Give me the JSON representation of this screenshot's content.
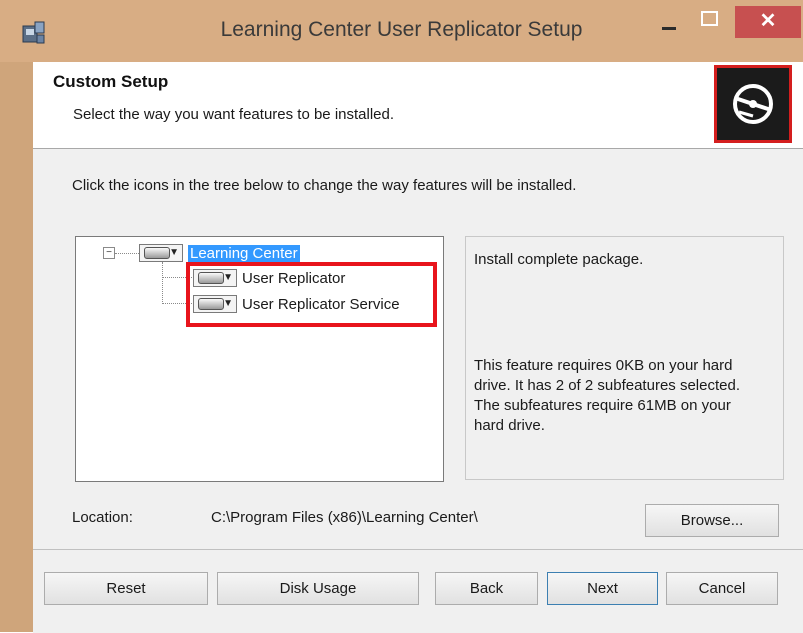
{
  "window": {
    "title": "Learning Center User Replicator Setup",
    "minimize_glyph": "–",
    "maximize_glyph": "□",
    "close_glyph": "✕"
  },
  "banner": {
    "title": "Custom Setup",
    "subtitle": "Select the way you want features to be installed.",
    "logo_icon": "install-disc-icon"
  },
  "instruction": "Click the icons in the tree below to change the way features will be installed.",
  "tree": {
    "root": {
      "label": "Learning Center",
      "expander": "−",
      "selected": true
    },
    "children": [
      {
        "label": "User Replicator"
      },
      {
        "label": "User Replicator Service"
      }
    ]
  },
  "info": {
    "description": "Install complete package.",
    "details": "This feature requires 0KB on your hard drive. It has 2 of 2 subfeatures selected. The subfeatures require 61MB on your hard drive."
  },
  "location": {
    "label": "Location:",
    "path": "C:\\Program Files (x86)\\Learning Center\\",
    "browse_label": "Browse..."
  },
  "buttons": {
    "reset": "Reset",
    "disk_usage": "Disk Usage",
    "back": "Back",
    "next": "Next",
    "cancel": "Cancel"
  },
  "colors": {
    "title_bar": "#d8ad84",
    "close_button": "#c75050",
    "selection": "#3399ff",
    "highlight_box": "#e8141c"
  }
}
